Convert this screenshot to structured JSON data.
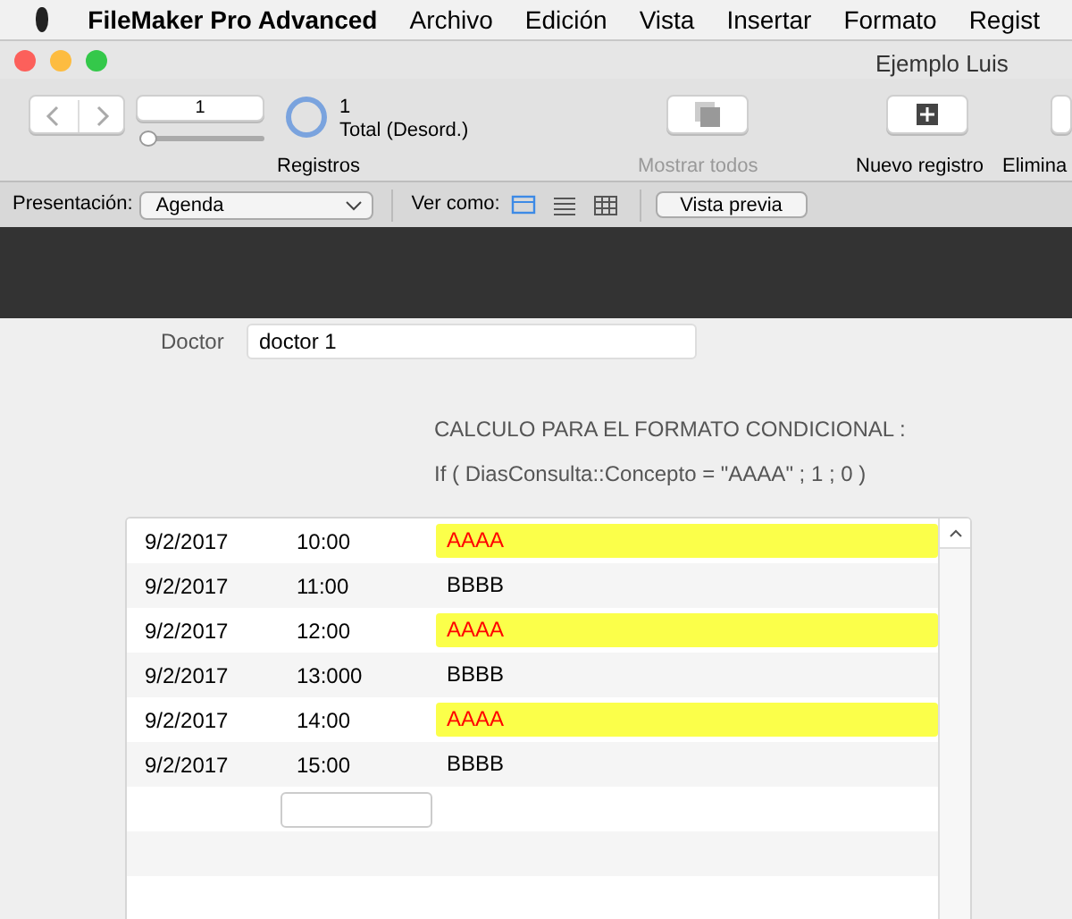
{
  "menu_bar": {
    "app": "FileMaker Pro Advanced",
    "items": [
      "Archivo",
      "Edición",
      "Vista",
      "Insertar",
      "Formato",
      "Regist"
    ]
  },
  "window": {
    "title": "Ejemplo Luis"
  },
  "toolbar": {
    "record_number": "1",
    "record_slider": {
      "level": 0.0
    },
    "found_count": "1",
    "found_status": "Total (Desord.)",
    "records_label": "Registros",
    "buttons": [
      {
        "kind": "show-all",
        "label": "Mostrar todos",
        "disabled": true
      },
      {
        "kind": "new",
        "label": "Nuevo registro",
        "disabled": false
      },
      {
        "kind": "delete",
        "label": "Elimina",
        "disabled": false
      }
    ]
  },
  "layout_bar": {
    "layout_label": "Presentación:",
    "layout": "Agenda",
    "view_label": "Ver como:",
    "view_modes": [
      {
        "kind": "form",
        "selected": true
      },
      {
        "kind": "list",
        "selected": false
      },
      {
        "kind": "table",
        "selected": false
      }
    ],
    "preview_button": "Vista previa"
  },
  "form": {
    "doctor_label": "Doctor",
    "doctor_value": "doctor 1",
    "calc_title": "CALCULO PARA EL FORMATO CONDICIONAL :",
    "calc_formula": "If ( DiasConsulta::Concepto = \"AAAA\" ; 1 ; 0 )"
  },
  "portal": {
    "rows": [
      {
        "date": "9/2/2017",
        "time": "10:00",
        "concept": "AAAA",
        "highlighted": true
      },
      {
        "date": "9/2/2017",
        "time": "11:00",
        "concept": "BBBB",
        "highlighted": false
      },
      {
        "date": "9/2/2017",
        "time": "12:00",
        "concept": "AAAA",
        "highlighted": true
      },
      {
        "date": "9/2/2017",
        "time": "13:000",
        "concept": "BBBB",
        "highlighted": false
      },
      {
        "date": "9/2/2017",
        "time": "14:00",
        "concept": "AAAA",
        "highlighted": true
      },
      {
        "date": "9/2/2017",
        "time": "15:00",
        "concept": "BBBB",
        "highlighted": false
      }
    ]
  }
}
